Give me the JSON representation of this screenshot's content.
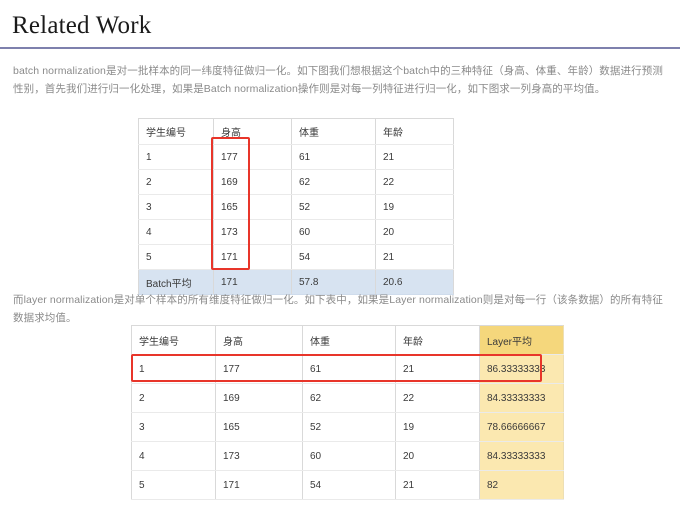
{
  "header": {
    "title": "Related Work",
    "rule_color": "#7e80ad"
  },
  "paragraphs": {
    "p1": "batch normalization是对一批样本的同一纬度特征做归一化。如下图我们想根据这个batch中的三种特征（身高、体重、年龄）数据进行预测性别，首先我们进行归一化处理，如果是Batch normalization操作则是对每一列特征进行归一化，如下图求一列身高的平均值。",
    "p2": "而layer normalization是对单个样本的所有维度特征做归一化。如下表中，如果是Layer normalization则是对每一行（该条数据）的所有特征数据求均值。"
  },
  "table_one": {
    "headers": [
      "学生编号",
      "身高",
      "体重",
      "年龄"
    ],
    "rows": [
      [
        "1",
        "177",
        "61",
        "21"
      ],
      [
        "2",
        "169",
        "62",
        "22"
      ],
      [
        "3",
        "165",
        "52",
        "19"
      ],
      [
        "4",
        "173",
        "60",
        "20"
      ],
      [
        "5",
        "171",
        "54",
        "21"
      ]
    ],
    "summary_row": [
      "Batch平均",
      "171",
      "57.8",
      "20.6"
    ],
    "summary_row_color": "#d7e3f1",
    "highlight_color": "#e8352a"
  },
  "table_two": {
    "headers": [
      "学生编号",
      "身高",
      "体重",
      "年龄",
      "Layer平均"
    ],
    "rows": [
      [
        "1",
        "177",
        "61",
        "21",
        "86.33333333"
      ],
      [
        "2",
        "169",
        "62",
        "22",
        "84.33333333"
      ],
      [
        "3",
        "165",
        "52",
        "19",
        "78.66666667"
      ],
      [
        "4",
        "173",
        "60",
        "20",
        "84.33333333"
      ],
      [
        "5",
        "171",
        "54",
        "21",
        "82"
      ]
    ],
    "highlight_column_header_color": "#f5d77c",
    "highlight_column_cell_color": "#fbe8b0",
    "highlight_color": "#e8352a"
  }
}
